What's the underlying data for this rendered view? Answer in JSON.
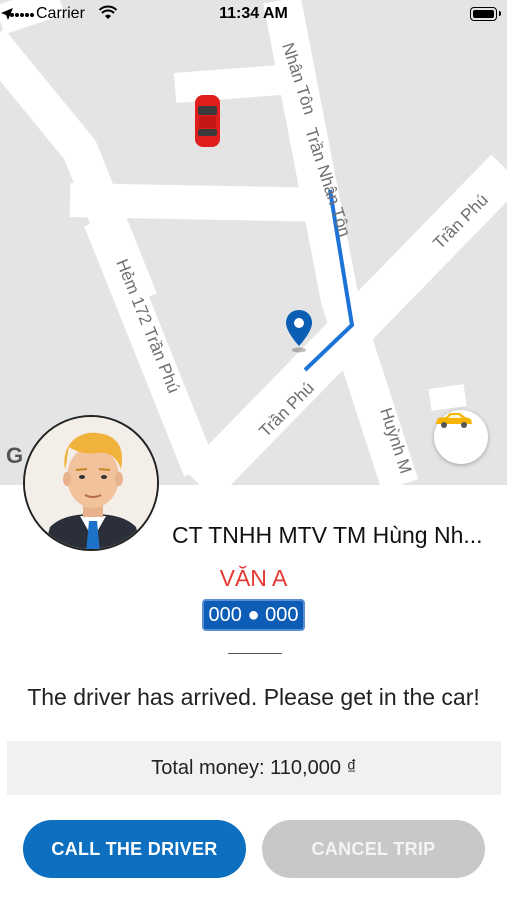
{
  "status_bar": {
    "carrier": "Carrier",
    "time": "11:34 AM"
  },
  "map": {
    "streets": {
      "tran_nhan_ton_top": "Nhân Tôn",
      "tran_nhan_ton": "Trần Nhân Tôn",
      "tran_phu_right": "Trần Phú",
      "hem_172": "Hẻm 172 Trần Phú",
      "tran_phu_bottom": "Trần Phú",
      "huynh": "Huỳnh M"
    },
    "google_mark": "G",
    "icons": [
      "car-marker-icon",
      "location-pin-icon",
      "taxi-icon"
    ],
    "colors": {
      "route": "#1e73d8",
      "pin": "#0a5fb4",
      "car": "#e01e1e"
    }
  },
  "driver": {
    "company": "CT TNHH MTV TM Hùng Nh...",
    "name": "VĂN A",
    "plate": "000 ● 000"
  },
  "trip": {
    "message": "The driver has arrived. Please get in the car!",
    "total": "Total money: 110,000 ₫"
  },
  "actions": {
    "call_label": "CALL THE DRIVER",
    "cancel_label": "CANCEL TRIP"
  },
  "colors": {
    "primary": "#0c6fbf",
    "driver_name": "#e53935",
    "plate_bg": "#0d5cb6",
    "cancel_bg": "#c8c8c8"
  }
}
